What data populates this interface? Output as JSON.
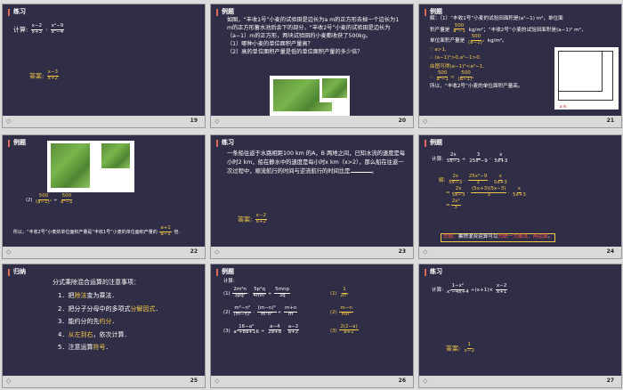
{
  "slides": [
    {
      "num": "19",
      "title": "练习",
      "label_calc": "计算:",
      "expr_parts": [
        "x−2",
        "x+3",
        "x²−9",
        "x²−4"
      ],
      "answer_label": "答案:",
      "answer": [
        "x−3",
        "x+2"
      ]
    },
    {
      "num": "20",
      "title": "例题",
      "text": "如图，“丰收1号”小麦的试验田是边长为a m的正方形去掉一个边长为1 m的正方形蓄水池后余下的部分，“丰收2号”小麦的试验田是边长为（a−1）m的正方形，两块试验田的小麦都收获了500kg。",
      "q1": "（1）哪种小麦的单位面积产量高？",
      "q2": "（2）高的单位面积产量是低的单位面积产量的多少倍？"
    },
    {
      "num": "21",
      "title": "例题",
      "l1": "解：（1）“丰收1号”小麦的试验田面积是(a²−1) m²，单位面",
      "l2a": "积产量是",
      "l2b": "kg/m²；“丰收2号”小麦的试验田面积是(a−1)² m²，",
      "l3a": "单位面积产量是",
      "l3b": "kg/m²。",
      "l4": "∵ a>1,",
      "l5": "∴ (a−1)²>0,a²−1>0.",
      "l6": "由图可得(a−1)²<a²−1.",
      "l8": "所以，“丰收2号”小麦的单位面积产量高。",
      "frac_500": "500",
      "den1": "a²−1",
      "den2": "(a−1)²",
      "diagram_labels": [
        "1 m",
        "(a−1) m",
        "a m"
      ]
    },
    {
      "num": "22",
      "title": "例题",
      "step": "(2)",
      "conclusion": "所以，“丰收2号”小麦的单位面积产量是“丰收1号”小麦的单位面积产量的",
      "result": [
        "a+1",
        "a−1"
      ],
      "result_tail": "倍.",
      "diagram_labels": [
        "1 m",
        "(a−1) m",
        "a m"
      ]
    },
    {
      "num": "23",
      "title": "练习",
      "text": "一条船往返于水路相距100 km 的A，B 两地之间，已知水流的速度是每小时2 km，船在静水中的速度是每小时x km（x>2），那么船在往返一次过程中，顺流航行的时间与逆流航行的时间比是",
      "tail": "。",
      "answer_label": "答案:",
      "answer": [
        "x−2",
        "x+2"
      ]
    },
    {
      "num": "24",
      "title": "例题",
      "label_calc": "计算:",
      "label_sol": "解:",
      "summary_label": "总结：",
      "summary_a": "乘除混合运算可以",
      "summary_b": "先统一为乘法，再运算",
      "summary_c": "。"
    },
    {
      "num": "25",
      "title": "归纳",
      "heading": "分式乘除混合运算的注意事项：",
      "items": [
        {
          "pre": "1．把",
          "hl": "除法",
          "post": "变为乘法．"
        },
        {
          "pre": "2．把分子分母中的多项式",
          "hl": "分解因式",
          "post": "．"
        },
        {
          "pre": "3．能约分的先",
          "hl": "约分",
          "post": "．"
        },
        {
          "pre": "4．",
          "hl": "从左到右",
          "post": "，依次计算．"
        },
        {
          "pre": "5．注意运算",
          "hl": "符号",
          "post": "．"
        }
      ]
    },
    {
      "num": "26",
      "title": "例题",
      "label_calc": "计算:",
      "p1": "(1)",
      "p2": "(2)",
      "p3": "(3)",
      "ans_prefix": [
        "(1)",
        "(2)",
        "(3)"
      ]
    },
    {
      "num": "27",
      "title": "练习",
      "label_calc": "计算:",
      "answer_label": "答案:",
      "answer": [
        "1",
        "x−2"
      ]
    }
  ],
  "colors": {
    "slide_bg": "#2f2e46",
    "accent": "#f3c84b",
    "red": "#ff5c4a"
  }
}
